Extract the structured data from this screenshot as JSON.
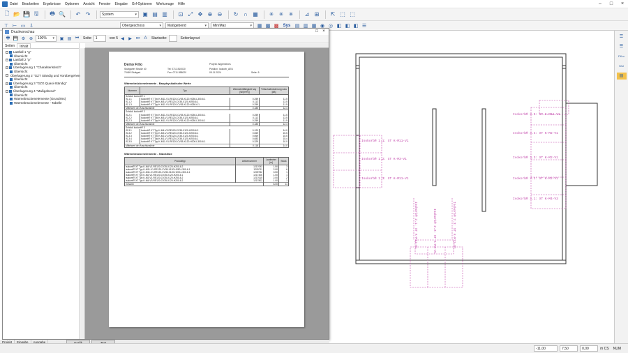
{
  "menu": [
    "Datei",
    "Bearbeiten",
    "Ergebnisse",
    "Optionen",
    "Ansicht",
    "Fenster",
    "Eingabe",
    "Grf-Optionen",
    "Werkzeuge",
    "Hilfe"
  ],
  "toolbar": {
    "system_dropdown": "System"
  },
  "toolbar2": {
    "layer1": "Obergeschoss",
    "layer2": "Maßgebend",
    "layer3": "Min/Max",
    "sys_label": "Sys"
  },
  "preview": {
    "title": "Druckvorschau",
    "zoom": "100%",
    "page_label": "Seite:",
    "page_num": "1",
    "page_of": "von 5",
    "start_label": "Startseite:",
    "layout_label": "Seitenlayout",
    "tabs": [
      "Seiten",
      "Inhalt"
    ],
    "tree": [
      {
        "label": "Lastfall 1 \"g\"",
        "level": 0
      },
      {
        "label": "Übersicht",
        "level": 1
      },
      {
        "label": "Lastfall 2 \"p\"",
        "level": 0
      },
      {
        "label": "Übersicht",
        "level": 1
      },
      {
        "label": "Überlagerung 1 \"Charakteristisch\"",
        "level": 0
      },
      {
        "label": "Übersicht",
        "level": 1
      },
      {
        "label": "Überlagerung 2 \"GZT Ständig und Vorübergehend\"",
        "level": 0
      },
      {
        "label": "Übersicht",
        "level": 1
      },
      {
        "label": "Überlagerung 3 \"GZG Quasi-Ständig\"",
        "level": 0
      },
      {
        "label": "Übersicht",
        "level": 1
      },
      {
        "label": "Überlagerung 4 \"Maßgebend\"",
        "level": 0
      },
      {
        "label": "Übersicht",
        "level": 1
      },
      {
        "label": "Wärmebrückenelemente (Grundriss)",
        "level": 1
      },
      {
        "label": "Wärmebrückenelemente - Tabelle",
        "level": 1
      }
    ]
  },
  "page": {
    "company": "Demo Frilo",
    "street": "Stuttgarter Straße 40",
    "city": "70469   Stuttgart",
    "tel": "Tel: 0711 810020",
    "fax": "Fax: 0711 858020",
    "projekt": "Projekt: Allgemeines",
    "position": "Position: Isokorb_AEU",
    "date": "05.11.2024",
    "seite": "Seite: 5",
    "section1": "Wärmebrückenelemente - Bauphysikalische Werte",
    "t1_headers": [
      "Nummer",
      "Typ",
      "Wärmeleitfähigkeit λeq [W/(m*K)]",
      "Trittschallminderung ΔLw [dB]"
    ],
    "t1_groups": [
      {
        "title": "Schöck Isokorb® 1",
        "rows": [
          [
            "IS-1.1",
            "Isokorb® XT Typ K-M11-V1-RE120-CV35-X120-H250-L300-6.1",
            "0.259",
            "11.5"
          ],
          [
            "IS-1.2",
            "Isokorb® XT Typ K-M3-V1-RE120-CV35-X120-H250-6.1",
            "0.112",
            "13.5"
          ],
          [
            "IS-1.3",
            "Isokorb® XT Typ K-M11-V1-RE120-CV35-X120-H250-6.1",
            "0.259",
            "11.5"
          ]
        ],
        "mean": [
          "Mittelwert der Anschlusslinie",
          "0.185",
          "12.4"
        ]
      },
      {
        "title": "Schöck Isokorb® 2",
        "rows": [
          [
            "IS-2.1",
            "Isokorb® XT Typ K-M11-V1-RE120-CV35-X120-H250-L300-6.1",
            "0.259",
            "11.5"
          ],
          [
            "IS-2.2",
            "Isokorb® XT Typ K-M3-V1-RE120-CV35-X120-H250-6.1",
            "0.112",
            "13.5"
          ],
          [
            "IS-2.3",
            "Isokorb® XT Typ K-M11-V1-RE120-CV35-X120-H250-L300-6.1",
            "0.259",
            "11.5"
          ]
        ],
        "mean": [
          "Mittelwert der Anschlusslinie",
          "0.185",
          "12.4"
        ]
      },
      {
        "title": "Schöck Isokorb® 3",
        "rows": [
          [
            "IS-3.1",
            "Isokorb® XT Typ K-M4-V3-RE120-CV35-X120-H200-6.2",
            "0.120",
            "14.0"
          ],
          [
            "IS-3.2",
            "Isokorb® XT Typ K-M2-V1-RE120-CV35-X120-H200-6.1",
            "0.069",
            "15.5"
          ],
          [
            "IS-3.3",
            "Isokorb® XT Typ K-M2-V1-RE120-CV35-X120-H200-6.1",
            "0.069",
            "15.5"
          ],
          [
            "IS-3.4",
            "Isokorb® XT Typ K-M1-V1-RE120-CV35-X120-H200-6.1",
            "0.083",
            "15.4"
          ],
          [
            "IS-3.5",
            "Isokorb® XT Typ K-M11-V1-RE120-CV35-X120-H200-L300-6.1",
            "0.329",
            "10.0"
          ]
        ],
        "mean": [
          "Mittelwert der Anschlusslinie",
          "0.118",
          "14.0"
        ]
      }
    ],
    "section2": "Wärmebrückenelemente - Stückliste",
    "t2_headers": [
      "Produkttyp",
      "Artikelnummer",
      "Laufmeter [m]",
      "Stück"
    ],
    "t2_rows": [
      [
        "Isokorb® XT Typ K-M4-V1-RE120-CV35-X120-H200-6.2",
        "1217093",
        "1.50",
        "3"
      ],
      [
        "Isokorb® XT Typ K-M11-V1-RE120-CV35-X120-H250-L300-6.1",
        "1209711",
        "2.00",
        "6"
      ],
      [
        "Isokorb® XT Typ K-M11-V1-RE120-CV35-X120-H200-L300-6.1",
        "1209752",
        "0.50",
        "1"
      ],
      [
        "Isokorb® XT Typ K-M2-V1-RE120-CV35-X120-H200-6.1",
        "1217406",
        "1.00",
        "1"
      ],
      [
        "Isokorb® XT Typ K-M3-V1-RE120-CV35-X120-H250-6.2",
        "1217615",
        "2.00",
        "2"
      ],
      [
        "Isokorb® XT Typ K-M4-V3-RE120-CV35-X120-H200-6.2",
        "1217802",
        "1.00",
        "1"
      ]
    ],
    "t2_total": [
      "Gesamt",
      "8.00",
      "11"
    ]
  },
  "drawing_labels": {
    "l1": "Isokorb® 1.1: XT K-M11-V1",
    "l2": "Isokorb® 1.2: XT K-M3-V1",
    "l3": "Isokorb® 1.3: XT K-M11-V1",
    "r1": "Isokorb® 3.5: XT K-M11-V1",
    "r2": "Isokorb® 3.4: XT K-M2-V1",
    "r3": "Isokorb® 3.3: XT K-M2-V1",
    "r4": "Isokorb® 3.2: XT K-M2-V1",
    "r5": "Isokorb® 3.1: XT K-M4-V3",
    "v1": "Isokorb® 2.1: XT K-M11-V1",
    "v2": "Isokorb® 2.2: XT K-M3-V1",
    "v3": "Isokorb® 2.3: XT K-M11-V1"
  },
  "bottom_tabs": [
    "Projekt",
    "Eingabe",
    "Ausgabe"
  ],
  "graphic_tabs": [
    "Grafik",
    "Text"
  ],
  "rightbar": {
    "pkor": "PKor",
    "wol": "Wol"
  },
  "status": {
    "x": "-11,00",
    "y": "7,50",
    "z": "0,00",
    "unit": "m CS",
    "num": "NUM"
  },
  "colors": {
    "accent": "#2a6db5",
    "isokorb": "#c040a8",
    "wall": "#333333"
  }
}
